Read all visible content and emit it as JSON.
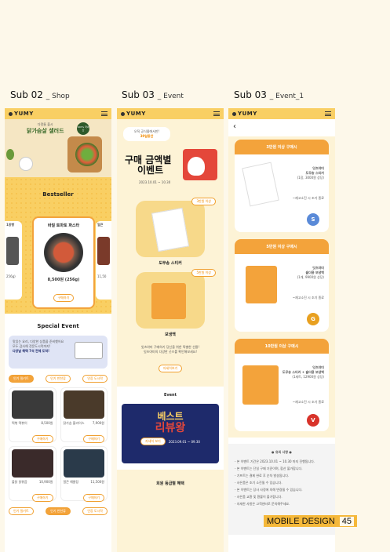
{
  "labels": {
    "shop_main": "Sub 02",
    "shop_sub": "_ Shop",
    "event_main": "Sub 03",
    "event_sub": "_ Event",
    "event1_main": "Sub 03",
    "event1_sub": "_ Event_1"
  },
  "brand": {
    "logo": "YUMY"
  },
  "shop": {
    "hero_tag": "다맛들 출시",
    "hero_title": "닭가슴살 샐러드",
    "hero_badge": "100% 국내산",
    "bestseller_title": "Bestseller",
    "side_left_label": "1창빵",
    "side_left_price": "256g)",
    "side_right_label": "얼큰",
    "side_right_price": "11,50",
    "product_name": "바질 토마토 파스타",
    "product_price": "8,500원 (256g)",
    "product_button": "구매하기",
    "special_event_title": "Special Event",
    "event_line1": "맛있는 요리, 다양한 상품을 준비했어요",
    "event_line2": "모두 감사해 전문도시락까지!",
    "event_line3": "다양날 해택 7석 전체 도착!",
    "tabs": [
      "인기 밀키트",
      "인기 반찬류",
      "인증 도시락"
    ],
    "cards": [
      {
        "name": "떡볶 떡볶이",
        "price": "8,500원",
        "btn": "구매하기"
      },
      {
        "name": "닭가슴 볼라이스",
        "price": "7,900원",
        "btn": "구매하기"
      },
      {
        "name": "불닭 닭볶음",
        "price": "10,900원",
        "btn": "구매하기"
      },
      {
        "name": "얼큰 해물탕",
        "price": "11,500원",
        "btn": "구매하기"
      }
    ]
  },
  "event": {
    "bubble_line1": "오직 공식몰에서만!",
    "bubble_line2": "30일동안",
    "title_line1": "구매 금액별",
    "title_line2": "이벤트",
    "date": "2023.10.01 ~ 10.30",
    "badge1": "3만원 이상",
    "item1": "도무송 스티커",
    "badge2": "5만원 이상",
    "item2": "보냉백",
    "note_line1": "잇츠야미 구매하기 당신을 위한 특별한 선물!",
    "note_line2": "잇츠야미의 다양한 굿즈를 확인해보세요!",
    "more_button": "자세히보기",
    "event_title": "Event",
    "banner_line1": "베스트",
    "banner_line2": "리뷰왕",
    "banner_btn": "자세히 보기",
    "banner_date": "2023.09.01 ~ 09.30",
    "member_title": "회원 등급별 혜택"
  },
  "event1": {
    "back_icon": "chevron-left-icon",
    "tiers": [
      {
        "head": "3만원 이상 구매시",
        "gift_line1": "잇츠야미",
        "gift_line2": "도무송 스티커",
        "price": "(1장, 3000원 상당)",
        "note": "~재고소진 시 조기 종료",
        "badge": "S"
      },
      {
        "head": "5만원 이상 구매시",
        "gift_line1": "잇츠야미",
        "gift_line2": "숄더용 보냉백",
        "price": "(1개, 9900원 상당)",
        "note": "~재고소진 시 조기 종료",
        "badge": "G"
      },
      {
        "head": "10만원 이상 구매시",
        "gift_line1": "잇츠야미",
        "gift_line2": "도무송 스티커 + 숄더용 보냉백",
        "price": "(1세트, 12900원 상당)",
        "note": "~재고소진 시 조기 종료",
        "badge": "V"
      }
    ],
    "notice_title": "● 유의 사항 ●",
    "notice_lines": [
      "- 본 이벤트 기간은 2023.10.01 ~ 10.30 까지 진행됩니다.",
      "- 본 이벤트는 단일 구매 기준이며, 합산 불가합니다.",
      "- 기프트는 결제 완료 후 순차 발송됩니다.",
      "- 사은품은 조기 소진될 수 있습니다.",
      "- 본 이벤트는 당사 사정에 의해 변경될 수 있습니다.",
      "- 사은품 교환 및 환불이 불가합니다.",
      "- 자세한 사항은 고객센터로 문의해주세요."
    ]
  },
  "footer": {
    "title": "MOBILE DESIGN",
    "page": "45"
  },
  "colors": {
    "header": "#f9cf63",
    "accent": "#f3a33b",
    "cream": "#fdf3d6",
    "navy": "#1e2a6b"
  }
}
